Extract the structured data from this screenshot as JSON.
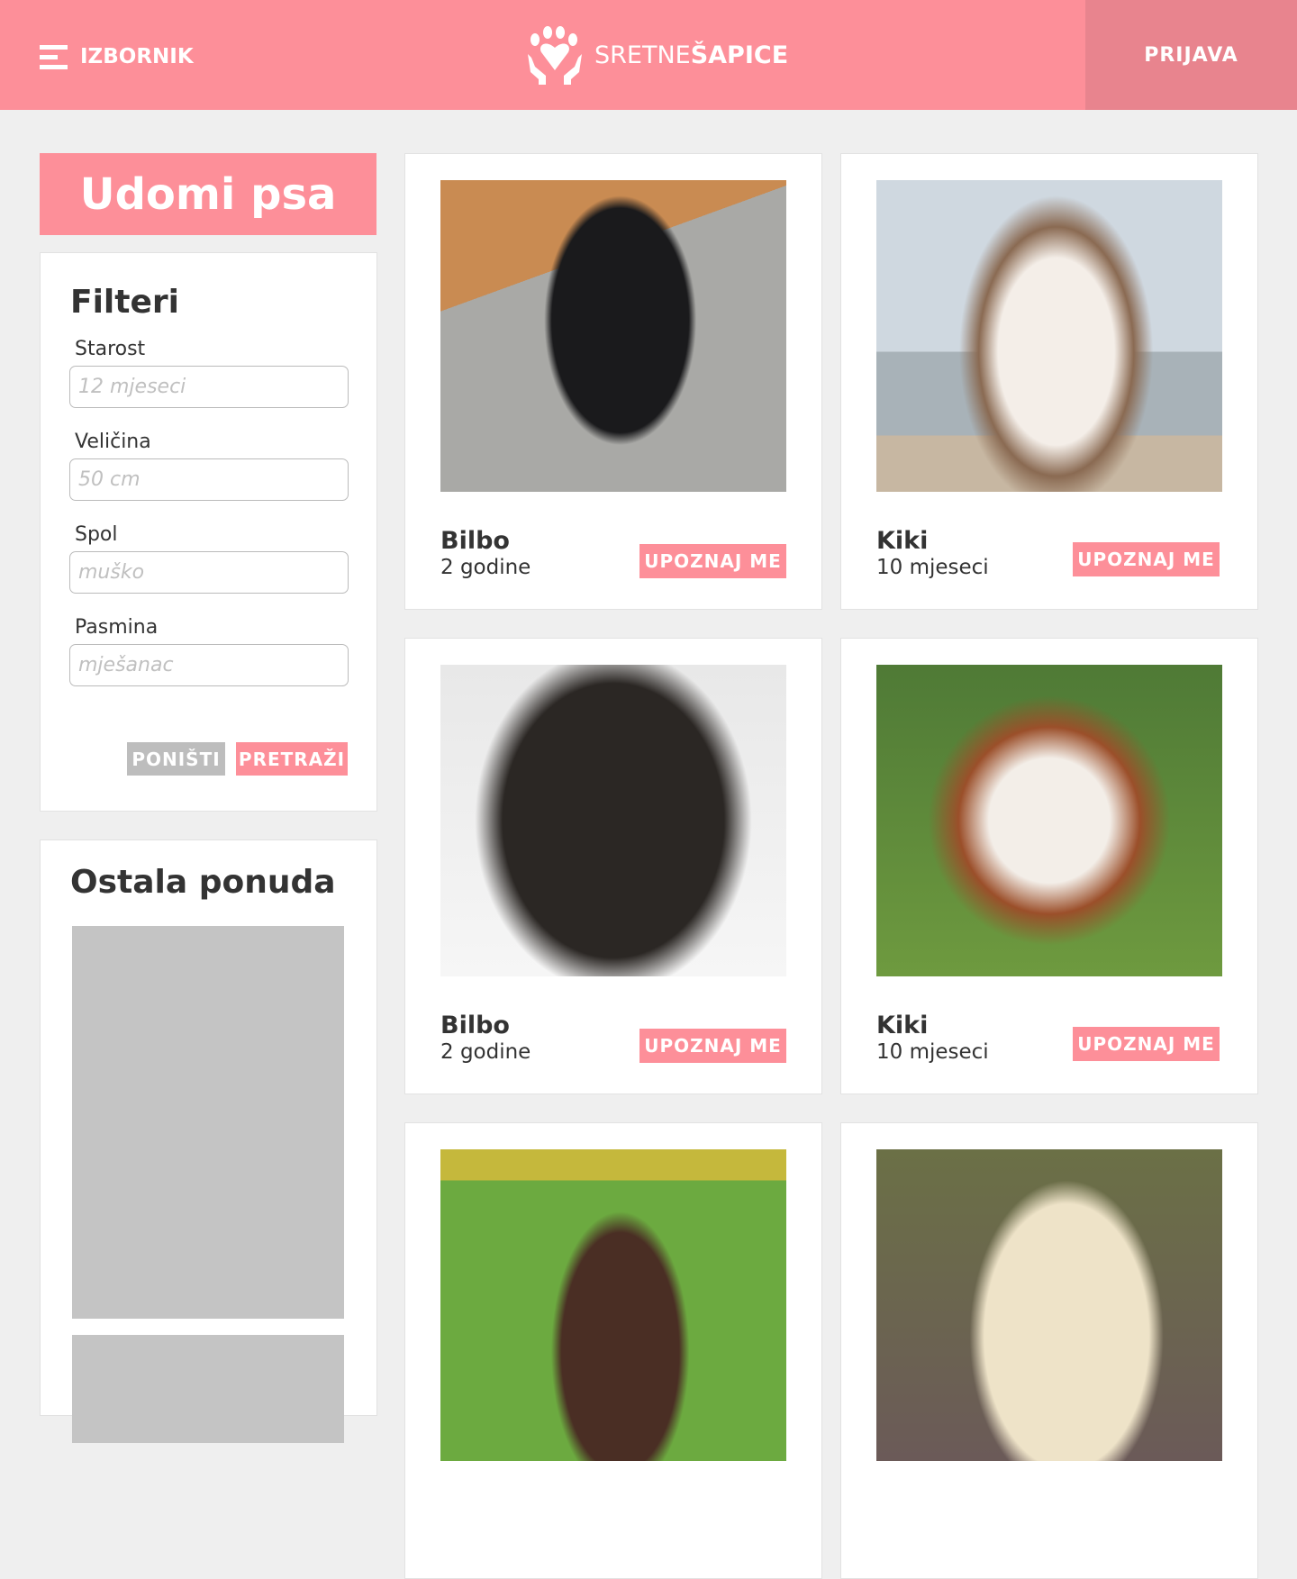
{
  "header": {
    "menu_label": "IZBORNIK",
    "logo_light": "SRETNE",
    "logo_bold": "ŠAPICE",
    "login_label": "PRIJAVA"
  },
  "sidebar": {
    "banner_title": "Udomi psa",
    "filters": {
      "title": "Filteri",
      "fields": [
        {
          "label": "Starost",
          "placeholder": "12 mjeseci"
        },
        {
          "label": "Veličina",
          "placeholder": "50 cm"
        },
        {
          "label": "Spol",
          "placeholder": "muško"
        },
        {
          "label": "Pasmina",
          "placeholder": "mješanac"
        }
      ],
      "reset_label": "PONIŠTI",
      "search_label": "PRETRAŽI"
    },
    "other_title": "Ostala ponuda"
  },
  "dogs": [
    {
      "name": "Bilbo",
      "age": "2 godine",
      "button": "UPOZNAJ ME",
      "photo": "black-griffon-dog"
    },
    {
      "name": "Kiki",
      "age": "10 mjeseci",
      "button": "UPOZNAJ ME",
      "photo": "husky-dog"
    },
    {
      "name": "Bilbo",
      "age": "2 godine",
      "button": "UPOZNAJ ME",
      "photo": "black-pitbull-dog"
    },
    {
      "name": "Kiki",
      "age": "10 mjeseci",
      "button": "UPOZNAJ ME",
      "photo": "cavalier-spaniel-dog"
    },
    {
      "name": "",
      "age": "",
      "button": "",
      "photo": "chocolate-labrador-puppy"
    },
    {
      "name": "",
      "age": "",
      "button": "",
      "photo": "golden-labrador-dog"
    }
  ],
  "colors": {
    "brand": "#fd8f99",
    "login_bg": "#e8848e",
    "reset": "#bdbdbd"
  }
}
